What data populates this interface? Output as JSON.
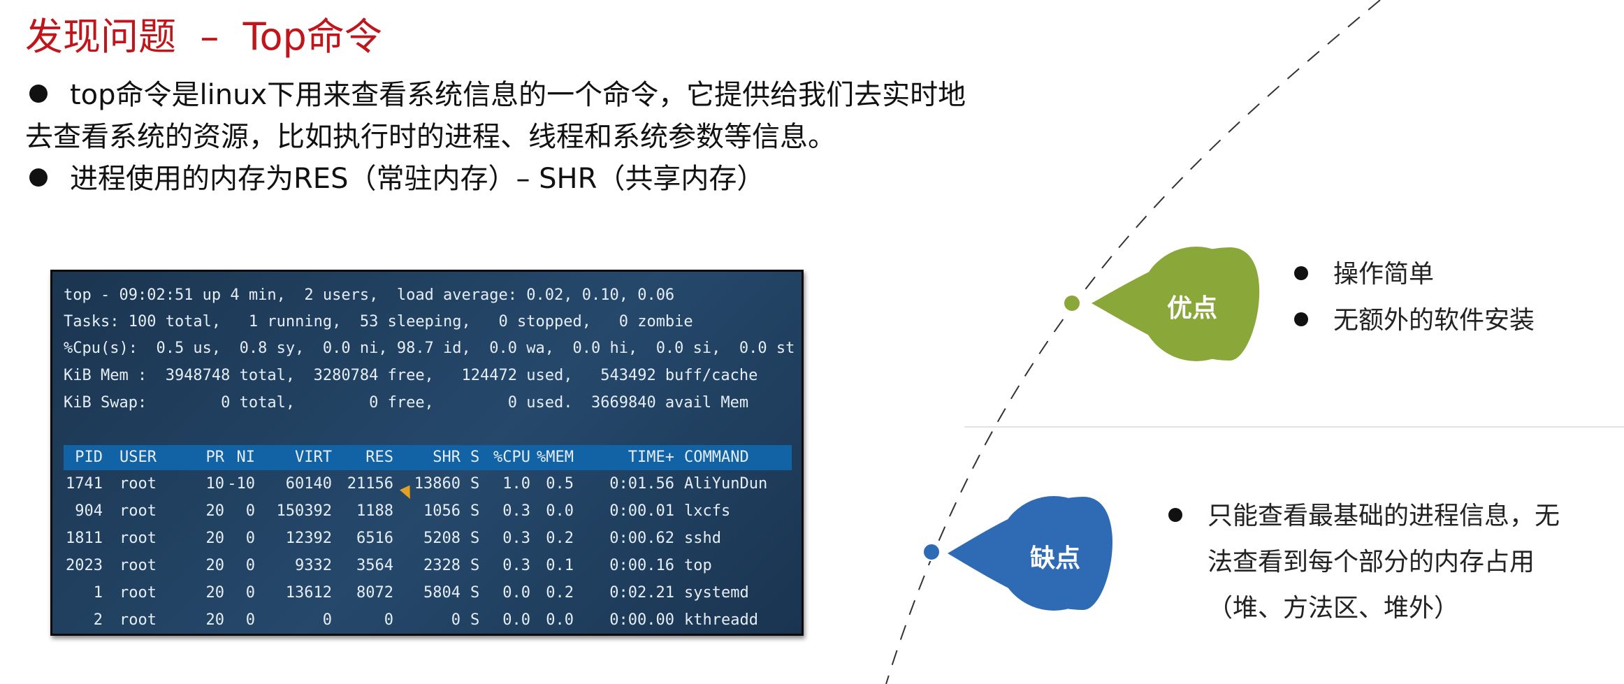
{
  "slide": {
    "title": "发现问题  –  Top命令",
    "bullets": [
      "top命令是linux下用来查看系统信息的一个命令，它提供给我们去实时地",
      "去查看系统的资源，比如执行时的进程、线程和系统参数等信息。",
      "进程使用的内存为RES（常驻内存）– SHR（共享内存）"
    ]
  },
  "terminal": {
    "summary": [
      "top - 09:02:51 up 4 min,  2 users,  load average: 0.02, 0.10, 0.06",
      "Tasks: 100 total,   1 running,  53 sleeping,   0 stopped,   0 zombie",
      "%Cpu(s):  0.5 us,  0.8 sy,  0.0 ni, 98.7 id,  0.0 wa,  0.0 hi,  0.0 si,  0.0 st",
      "KiB Mem :  3948748 total,  3280784 free,   124472 used,   543492 buff/cache",
      "KiB Swap:        0 total,        0 free,        0 used.  3669840 avail Mem"
    ],
    "columns": [
      "PID",
      "USER",
      "PR",
      "NI",
      "VIRT",
      "RES",
      "SHR",
      "S",
      "%CPU",
      "%MEM",
      "TIME+",
      "COMMAND"
    ],
    "rows": [
      [
        "1741",
        "root",
        "10",
        "-10",
        "60140",
        "21156",
        "13860",
        "S",
        "1.0",
        "0.5",
        "0:01.56",
        "AliYunDun"
      ],
      [
        "904",
        "root",
        "20",
        "0",
        "150392",
        "1188",
        "1056",
        "S",
        "0.3",
        "0.0",
        "0:00.01",
        "lxcfs"
      ],
      [
        "1811",
        "root",
        "20",
        "0",
        "12392",
        "6516",
        "5208",
        "S",
        "0.3",
        "0.2",
        "0:00.62",
        "sshd"
      ],
      [
        "2023",
        "root",
        "20",
        "0",
        "9332",
        "3564",
        "2328",
        "S",
        "0.3",
        "0.1",
        "0:00.16",
        "top"
      ],
      [
        "1",
        "root",
        "20",
        "0",
        "13612",
        "8072",
        "5804",
        "S",
        "0.0",
        "0.2",
        "0:02.21",
        "systemd"
      ],
      [
        "2",
        "root",
        "20",
        "0",
        "0",
        "0",
        "0",
        "S",
        "0.0",
        "0.0",
        "0:00.00",
        "kthreadd"
      ]
    ]
  },
  "pros": {
    "label": "优点",
    "color": "#8aa83a",
    "items": [
      "操作简单",
      "无额外的软件安装"
    ]
  },
  "cons": {
    "label": "缺点",
    "color": "#2f6bb5",
    "items": [
      "只能查看最基础的进程信息，无",
      "法查看到每个部分的内存占用",
      "（堆、方法区、堆外）"
    ]
  }
}
